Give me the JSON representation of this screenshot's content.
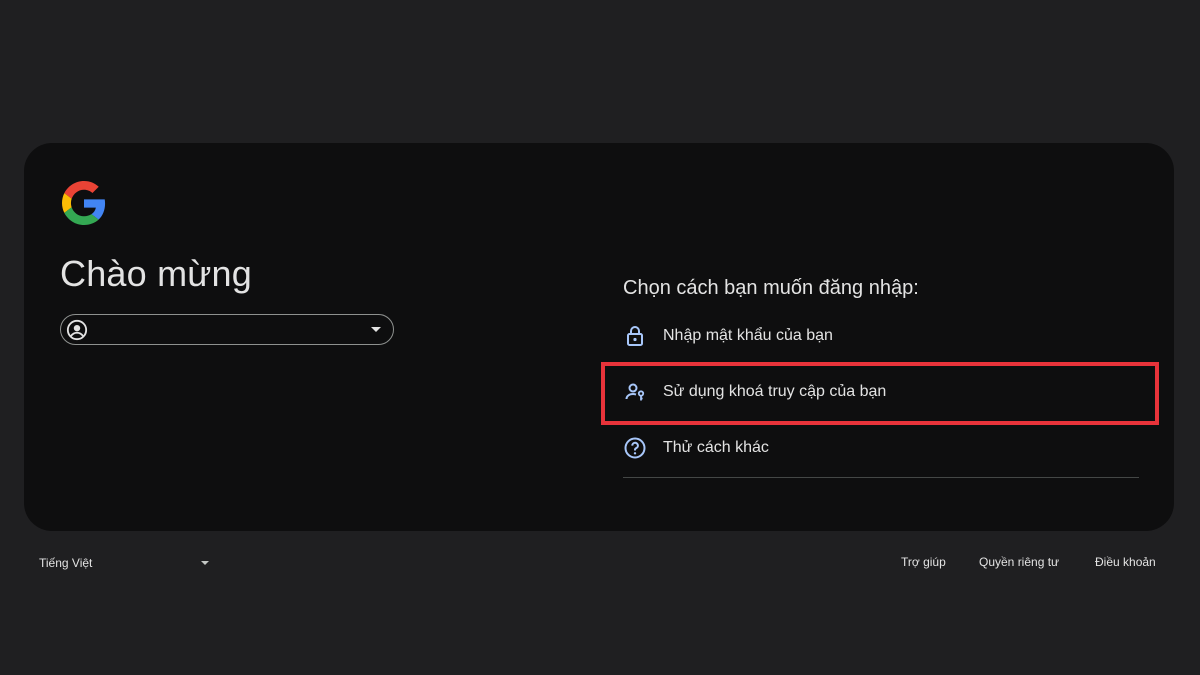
{
  "login": {
    "title": "Chào mừng",
    "account_email": "",
    "chooser_title": "Chọn cách bạn muốn đăng nhập:",
    "options": [
      {
        "label": "Nhập mật khẩu của bạn",
        "icon": "lock-icon"
      },
      {
        "label": "Sử dụng khoá truy cập của bạn",
        "icon": "passkey-icon",
        "highlighted": true
      },
      {
        "label": "Thử cách khác",
        "icon": "help-circle-icon"
      }
    ]
  },
  "footer": {
    "language": "Tiếng Việt",
    "links": [
      "Trợ giúp",
      "Quyền riêng tư",
      "Điều khoản"
    ]
  },
  "colors": {
    "page_bg": "#1f1f21",
    "card_bg": "#0e0e0f",
    "highlight": "#e8333a",
    "text": "#e3e3e3"
  }
}
